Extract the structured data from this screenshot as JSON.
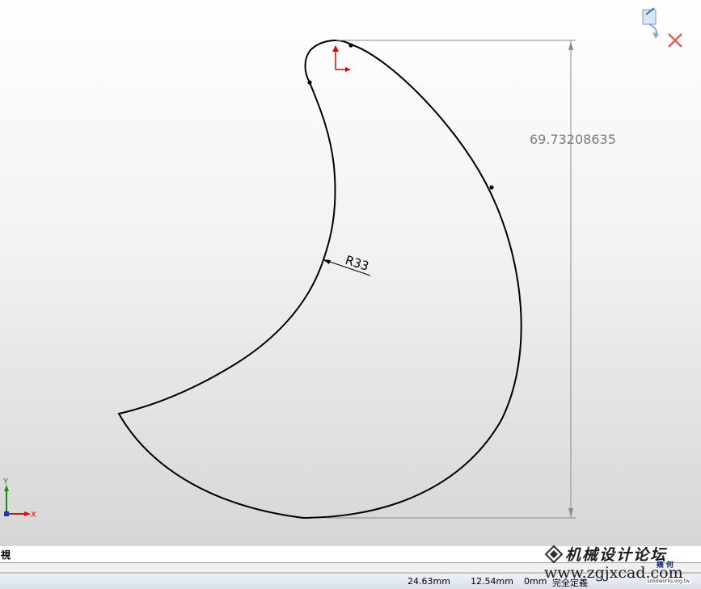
{
  "sketch": {
    "dimension_value": "69.73208635",
    "radius_label": "R33"
  },
  "triad": {
    "x_label": "X",
    "y_label": "Y"
  },
  "view": {
    "label": "視"
  },
  "status": {
    "x_coord": "24.63mm",
    "y_coord": "12.54mm",
    "z_coord": "0mm",
    "state": "完全定義"
  },
  "watermark": {
    "title": "机械设计论坛",
    "url": "www.zgjxcad.com",
    "site": "solidworks.org.tw",
    "badge": "幾 何"
  },
  "colors": {
    "origin": "#e00000",
    "triad_x": "#d01010",
    "triad_y": "#109010",
    "close": "#e06060"
  }
}
